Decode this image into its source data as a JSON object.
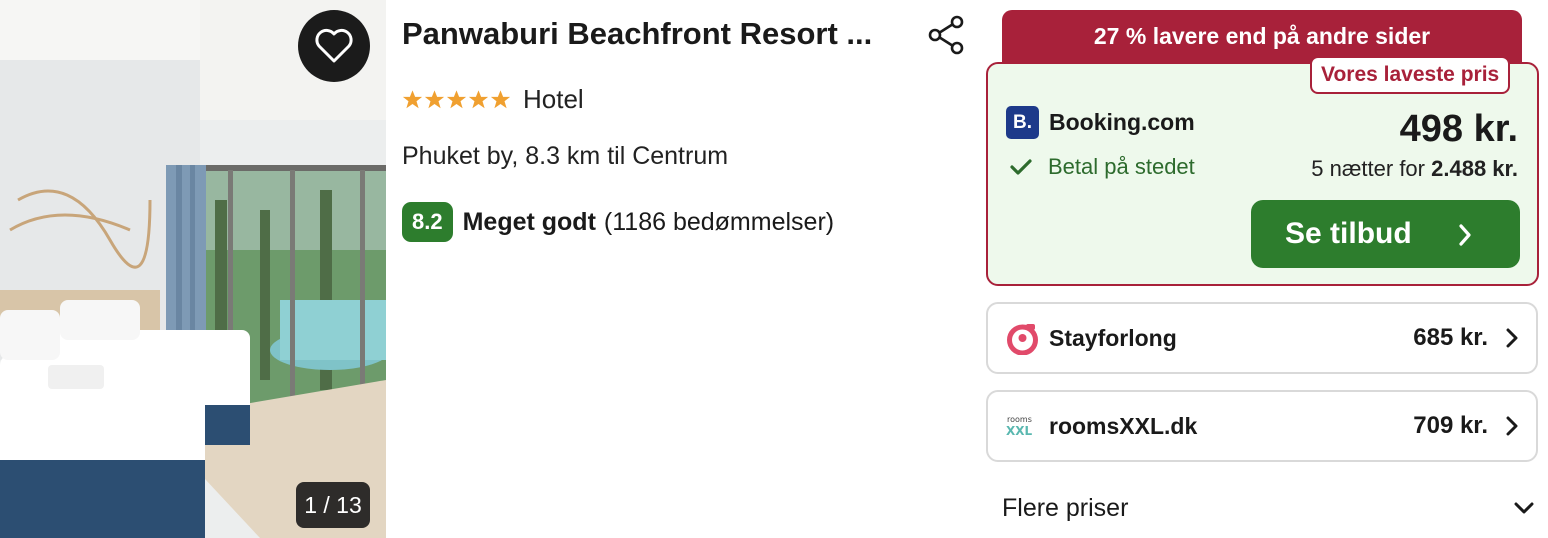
{
  "photo": {
    "counter": "1 / 13",
    "favorite_icon": "heart-outline-icon"
  },
  "hotel": {
    "name": "Panwaburi Beachfront Resort ...",
    "stars": 5,
    "type": "Hotel",
    "location": "Phuket by, 8.3 km til Centrum",
    "score": "8.2",
    "score_text": "Meget godt",
    "review_count": "(1186 bedømmelser)",
    "share_icon": "share-icon"
  },
  "deal": {
    "banner": "27 % lavere end på andre sider",
    "lowest_tag": "Vores laveste pris",
    "provider_logo_text": "B.",
    "provider": "Booking.com",
    "pay_text": "Betal på stedet",
    "price": "498 kr.",
    "nights_label": "5 nætter for",
    "total": "2.488 kr.",
    "cta": "Se tilbud"
  },
  "alternatives": [
    {
      "provider": "Stayforlong",
      "price": "685 kr.",
      "logo": "stayforlong-logo-icon"
    },
    {
      "provider": "roomsXXL.dk",
      "price": "709 kr.",
      "logo": "roomsxxl-logo-icon"
    }
  ],
  "more_prices": "Flere priser",
  "colors": {
    "brand_red": "#a8213a",
    "green": "#2d7d2d",
    "deal_bg": "#eef9ec",
    "star": "#f0a030"
  }
}
